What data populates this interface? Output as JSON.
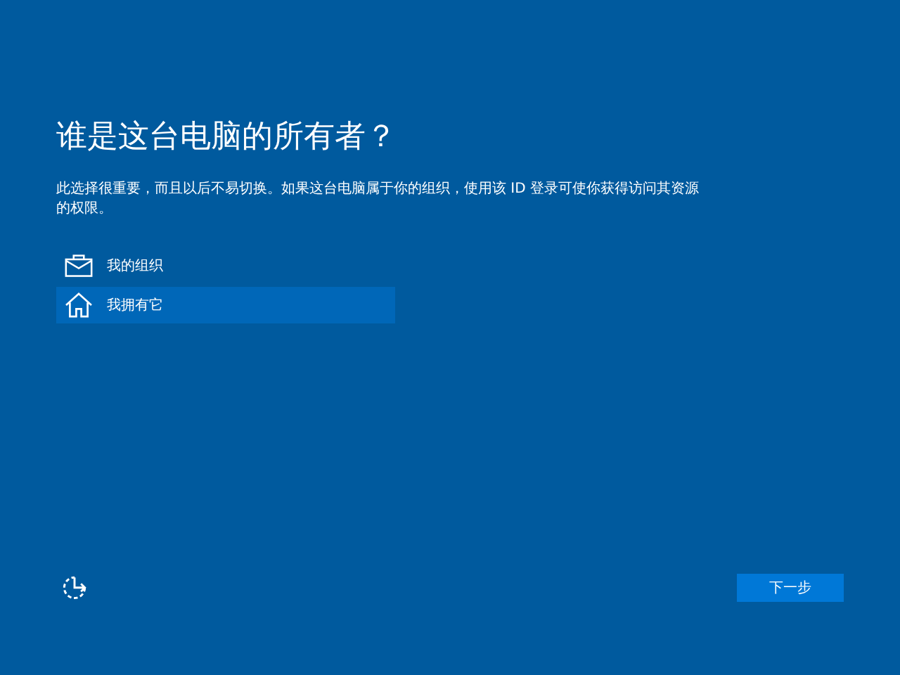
{
  "title": "谁是这台电脑的所有者？",
  "description": "此选择很重要，而且以后不易切换。如果这台电脑属于你的组织，使用该 ID 登录可使你获得访问其资源的权限。",
  "options": [
    {
      "kind": "organization",
      "label": "我的组织",
      "selected": false
    },
    {
      "kind": "personal",
      "label": "我拥有它",
      "selected": true
    }
  ],
  "next_button": "下一步"
}
